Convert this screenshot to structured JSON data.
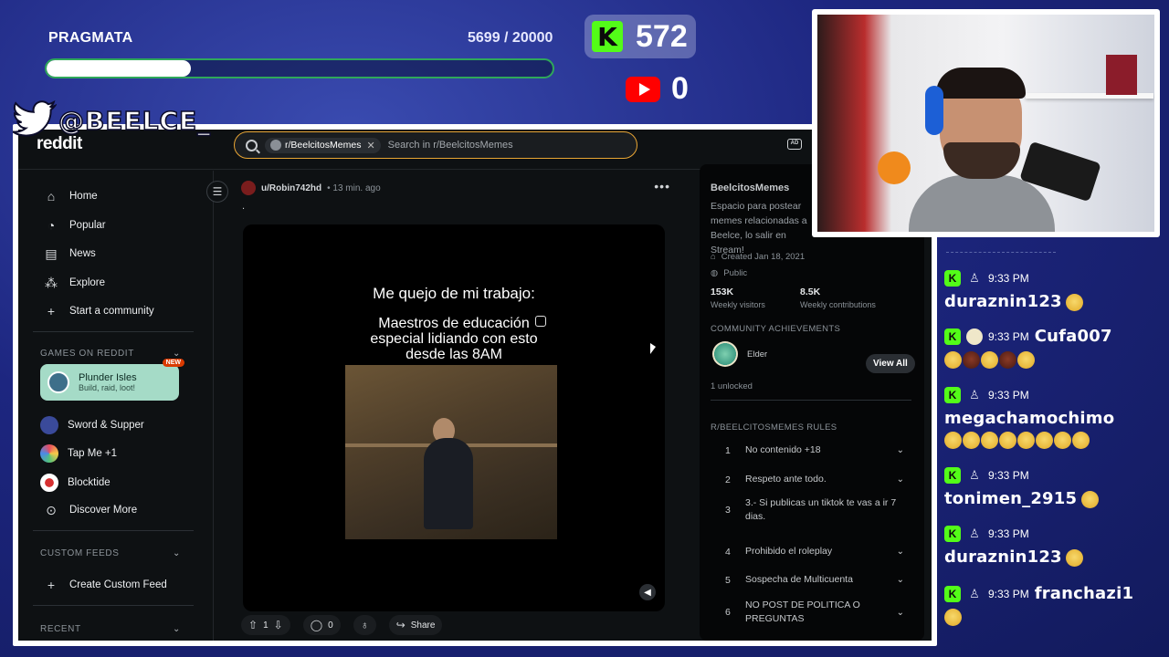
{
  "goal": {
    "title": "PRAGMATA",
    "count": "5699 / 20000",
    "progress_fraction": 0.285
  },
  "kick": {
    "followers": "572",
    "accent": "#53fc18"
  },
  "youtube": {
    "count": "0"
  },
  "twitter": {
    "handle": "@BEELCE_"
  },
  "reddit": {
    "logo": "reddit",
    "search": {
      "chip": "r/BeelcitosMemes",
      "placeholder": "Search in r/BeelcitosMemes"
    },
    "nav": [
      {
        "label": "Home",
        "icon": "home-icon"
      },
      {
        "label": "Popular",
        "icon": "popular-icon"
      },
      {
        "label": "News",
        "icon": "news-icon"
      },
      {
        "label": "Explore",
        "icon": "explore-icon"
      },
      {
        "label": "Start a community",
        "icon": "plus-icon"
      }
    ],
    "games": {
      "heading": "GAMES ON REDDIT",
      "featured": {
        "title": "Plunder Isles",
        "subtitle": "Build, raid, loot!",
        "badge": "NEW"
      },
      "items": [
        {
          "label": "Sword & Supper"
        },
        {
          "label": "Tap Me +1"
        },
        {
          "label": "Blocktide"
        },
        {
          "label": "Discover More"
        }
      ]
    },
    "custom_feeds": {
      "heading": "CUSTOM FEEDS",
      "create": "Create Custom Feed"
    },
    "recent": {
      "heading": "RECENT"
    },
    "post": {
      "user": "u/Robin742hd",
      "time": "• 13 min. ago",
      "body": ".",
      "meme_line1": "Me quejo de mi trabajo:",
      "meme_line2": "Maestros de educación especial lidiando con esto desde las 8AM",
      "upvotes": "1",
      "comments": "0",
      "share": "Share"
    },
    "sidebar": {
      "title": "BeelcitosMemes",
      "description": "Espacio para postear memes relacionadas a Beelce, lo salir en Stream!",
      "created": "Created Jan 18, 2021",
      "visibility": "Public",
      "visitors": "153K",
      "visitors_label": "Weekly visitors",
      "contributions": "8.5K",
      "contributions_label": "Weekly contributions",
      "achievements_heading": "COMMUNITY ACHIEVEMENTS",
      "achievement": "Elder",
      "unlocked": "1 unlocked",
      "view_all": "View All",
      "rules_heading": "R/BEELCITOSMEMES RULES",
      "rules": [
        {
          "num": "1",
          "text": "No contenido +18"
        },
        {
          "num": "2",
          "text": "Respeto ante todo."
        },
        {
          "num": "3",
          "text": "3.- Si publicas un tiktok te vas a ir 7 dias."
        },
        {
          "num": "4",
          "text": "Prohibido el roleplay"
        },
        {
          "num": "5",
          "text": "Sospecha de Multicuenta"
        },
        {
          "num": "6",
          "text": "NO POST DE POLITICA O PREGUNTAS"
        }
      ]
    }
  },
  "chat": [
    {
      "time": "9:33 PM",
      "user": "duraznin123"
    },
    {
      "time": "9:33 PM",
      "user": "Cufa007"
    },
    {
      "time": "9:33 PM",
      "user": "megachamochimo"
    },
    {
      "time": "9:33 PM",
      "user": "tonimen_2915"
    },
    {
      "time": "9:33 PM",
      "user": "duraznin123"
    },
    {
      "time": "9:33 PM",
      "user": "franchazi1"
    }
  ]
}
